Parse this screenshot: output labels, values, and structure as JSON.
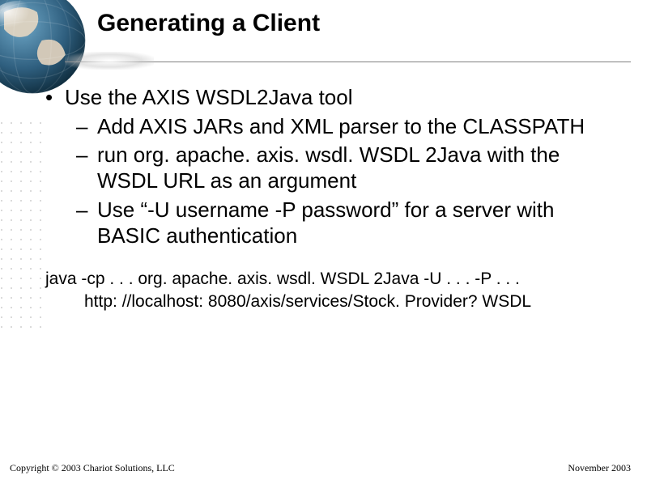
{
  "title": "Generating a Client",
  "bullets": {
    "l1": "Use the AXIS WSDL2Java tool",
    "l2a": "Add AXIS JARs and XML parser to the CLASSPATH",
    "l2b": "run org. apache. axis. wsdl. WSDL 2Java with the WSDL URL as an argument",
    "l2c": "Use “-U username -P password” for a server with BASIC authentication"
  },
  "code": {
    "line1": "java -cp . . . org. apache. axis. wsdl. WSDL 2Java -U . . . -P . . .",
    "line2": "http: //localhost: 8080/axis/services/Stock. Provider? WSDL"
  },
  "footer": {
    "copyright": "Copyright © 2003 Chariot Solutions, LLC",
    "date": "November 2003"
  }
}
